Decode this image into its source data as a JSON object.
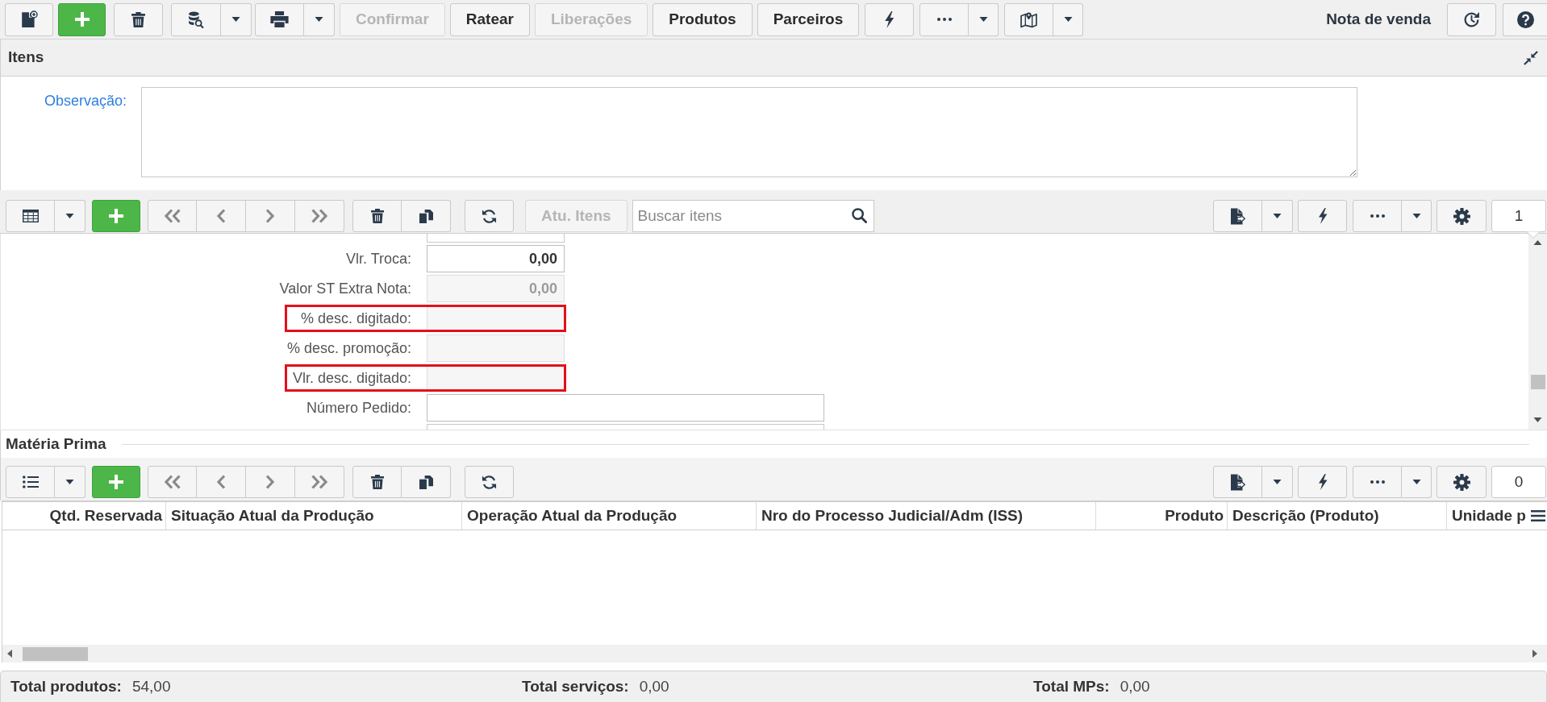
{
  "toolbar": {
    "buttons": [
      {
        "label": "Confirmar",
        "disabled": true
      },
      {
        "label": "Ratear",
        "disabled": false
      },
      {
        "label": "Liberações",
        "disabled": true
      },
      {
        "label": "Produtos",
        "disabled": false
      },
      {
        "label": "Parceiros",
        "disabled": false
      }
    ],
    "title": "Nota de venda"
  },
  "panel": {
    "title": "Itens",
    "observation_label": "Observação:"
  },
  "items_toolbar": {
    "update_button": {
      "label": "Atu. Itens",
      "disabled": true
    },
    "search": {
      "placeholder": "Buscar itens"
    },
    "page": "1"
  },
  "fields": [
    {
      "label": "Vlr. Troca:",
      "kind": "number",
      "value": "0,00",
      "disabled": false,
      "highlighted": false
    },
    {
      "label": "Valor ST Extra Nota:",
      "kind": "number",
      "value": "0,00",
      "disabled": true,
      "highlighted": false
    },
    {
      "label": "% desc. digitado:",
      "kind": "number",
      "disabled": true,
      "highlighted": true
    },
    {
      "label": "% desc. promoção:",
      "kind": "number",
      "disabled": true,
      "highlighted": false
    },
    {
      "label": "Vlr. desc. digitado:",
      "kind": "number",
      "disabled": true,
      "highlighted": true
    },
    {
      "label": "Número Pedido:",
      "kind": "text",
      "disabled": false,
      "highlighted": false
    }
  ],
  "raw_material": {
    "title": "Matéria Prima",
    "page": "0",
    "columns": [
      {
        "label": "Qtd. Reservada",
        "kind": "number"
      },
      {
        "label": "Situação Atual da Produção",
        "kind": "text"
      },
      {
        "label": "Operação Atual da Produção",
        "kind": "text"
      },
      {
        "label": "Nro do Processo Judicial/Adm (ISS)",
        "kind": "text"
      },
      {
        "label": "Produto",
        "kind": "number"
      },
      {
        "label": "Descrição (Produto)",
        "kind": "text"
      },
      {
        "label": "Unidade p",
        "kind": "text"
      }
    ]
  },
  "totals": [
    {
      "label": "Total produtos:",
      "value": "54,00"
    },
    {
      "label": "Total serviços:",
      "value": "0,00"
    },
    {
      "label": "Total MPs:",
      "value": "0,00"
    }
  ]
}
